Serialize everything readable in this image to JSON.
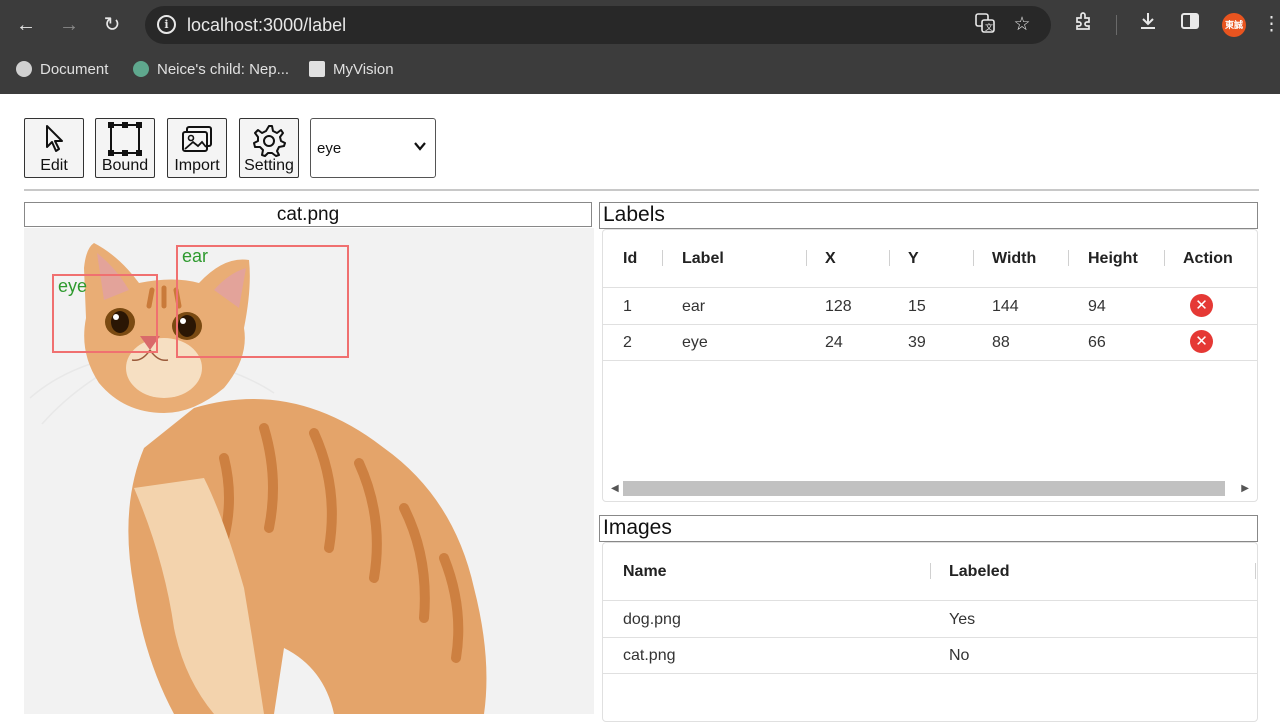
{
  "browser": {
    "url": "localhost:3000/label",
    "bookmarks": [
      "Document",
      "Neice's child: Nep...",
      "MyVision"
    ],
    "avatar_text": "東誠"
  },
  "toolbar": {
    "tools": [
      "Edit",
      "Bound",
      "Import",
      "Setting"
    ],
    "label_select_value": "eye"
  },
  "image_panel": {
    "title": "cat.png",
    "boxes": [
      {
        "label": "ear",
        "color": "#f07070"
      },
      {
        "label": "eye",
        "color": "#f07070"
      }
    ]
  },
  "labels": {
    "title": "Labels",
    "columns": [
      "Id",
      "Label",
      "X",
      "Y",
      "Width",
      "Height",
      "Action"
    ],
    "rows": [
      {
        "id": "1",
        "label": "ear",
        "x": "128",
        "y": "15",
        "width": "144",
        "height": "94"
      },
      {
        "id": "2",
        "label": "eye",
        "x": "24",
        "y": "39",
        "width": "88",
        "height": "66"
      }
    ]
  },
  "images": {
    "title": "Images",
    "columns": [
      "Name",
      "Labeled"
    ],
    "rows": [
      {
        "name": "dog.png",
        "labeled": "Yes"
      },
      {
        "name": "cat.png",
        "labeled": "No"
      }
    ]
  },
  "colors": {
    "chrome_bg": "#3c3c3c",
    "delete": "#e53935",
    "bbox": "#f07070",
    "bbox_label": "#2e9a2e"
  }
}
